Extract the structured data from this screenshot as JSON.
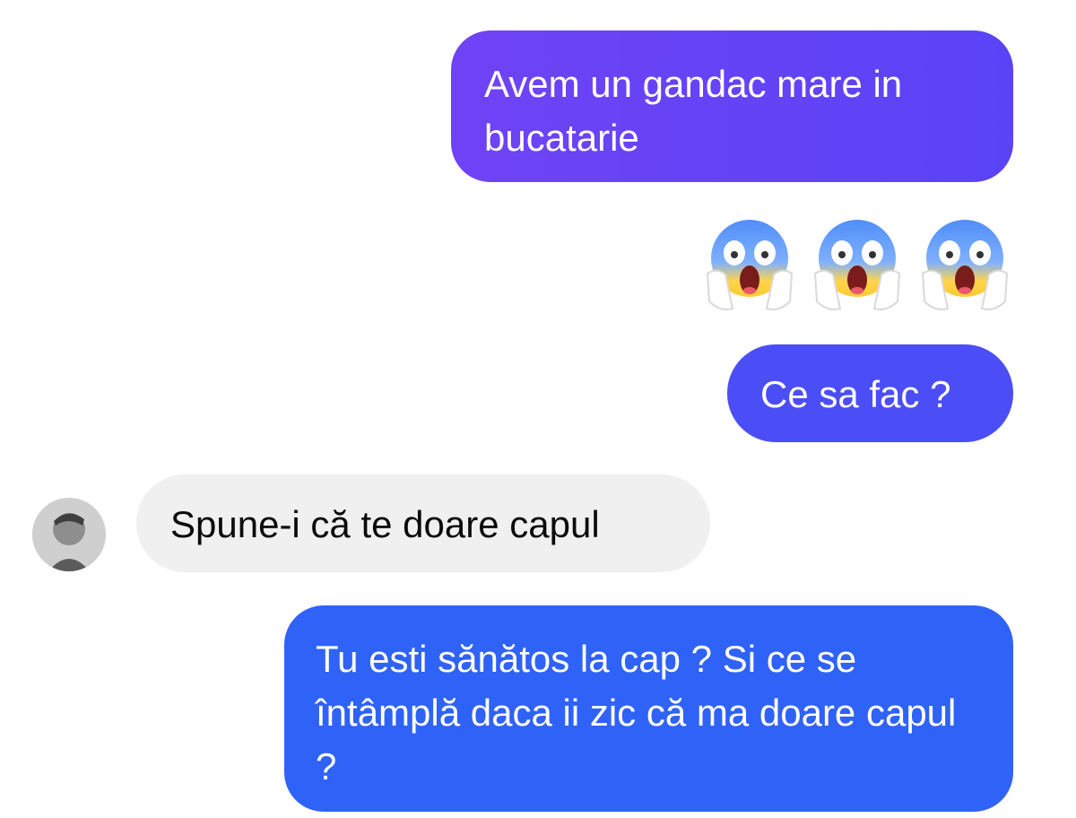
{
  "messages": [
    {
      "sender": "me",
      "text": "Avem un gandac mare in bucatarie"
    },
    {
      "sender": "me",
      "type": "emoji",
      "emojis": [
        "face-screaming-in-fear",
        "face-screaming-in-fear",
        "face-screaming-in-fear"
      ]
    },
    {
      "sender": "me",
      "text": "Ce sa fac ?"
    },
    {
      "sender": "contact",
      "text": "Spune-i că te doare capul"
    },
    {
      "sender": "me",
      "text": "Tu esti sănătos la cap ? Si ce se întâmplă daca ii zic că ma doare capul ?"
    }
  ],
  "colors": {
    "sent_bubble_top": "#6f43f5",
    "sent_bubble_middle": "#4b4ef6",
    "sent_bubble_bottom": "#2f62f7",
    "received_bubble": "#f0f0f0",
    "background": "#ffffff"
  },
  "icons": {
    "contact_avatar": "avatar-photo",
    "emoji": "face-screaming-in-fear"
  }
}
